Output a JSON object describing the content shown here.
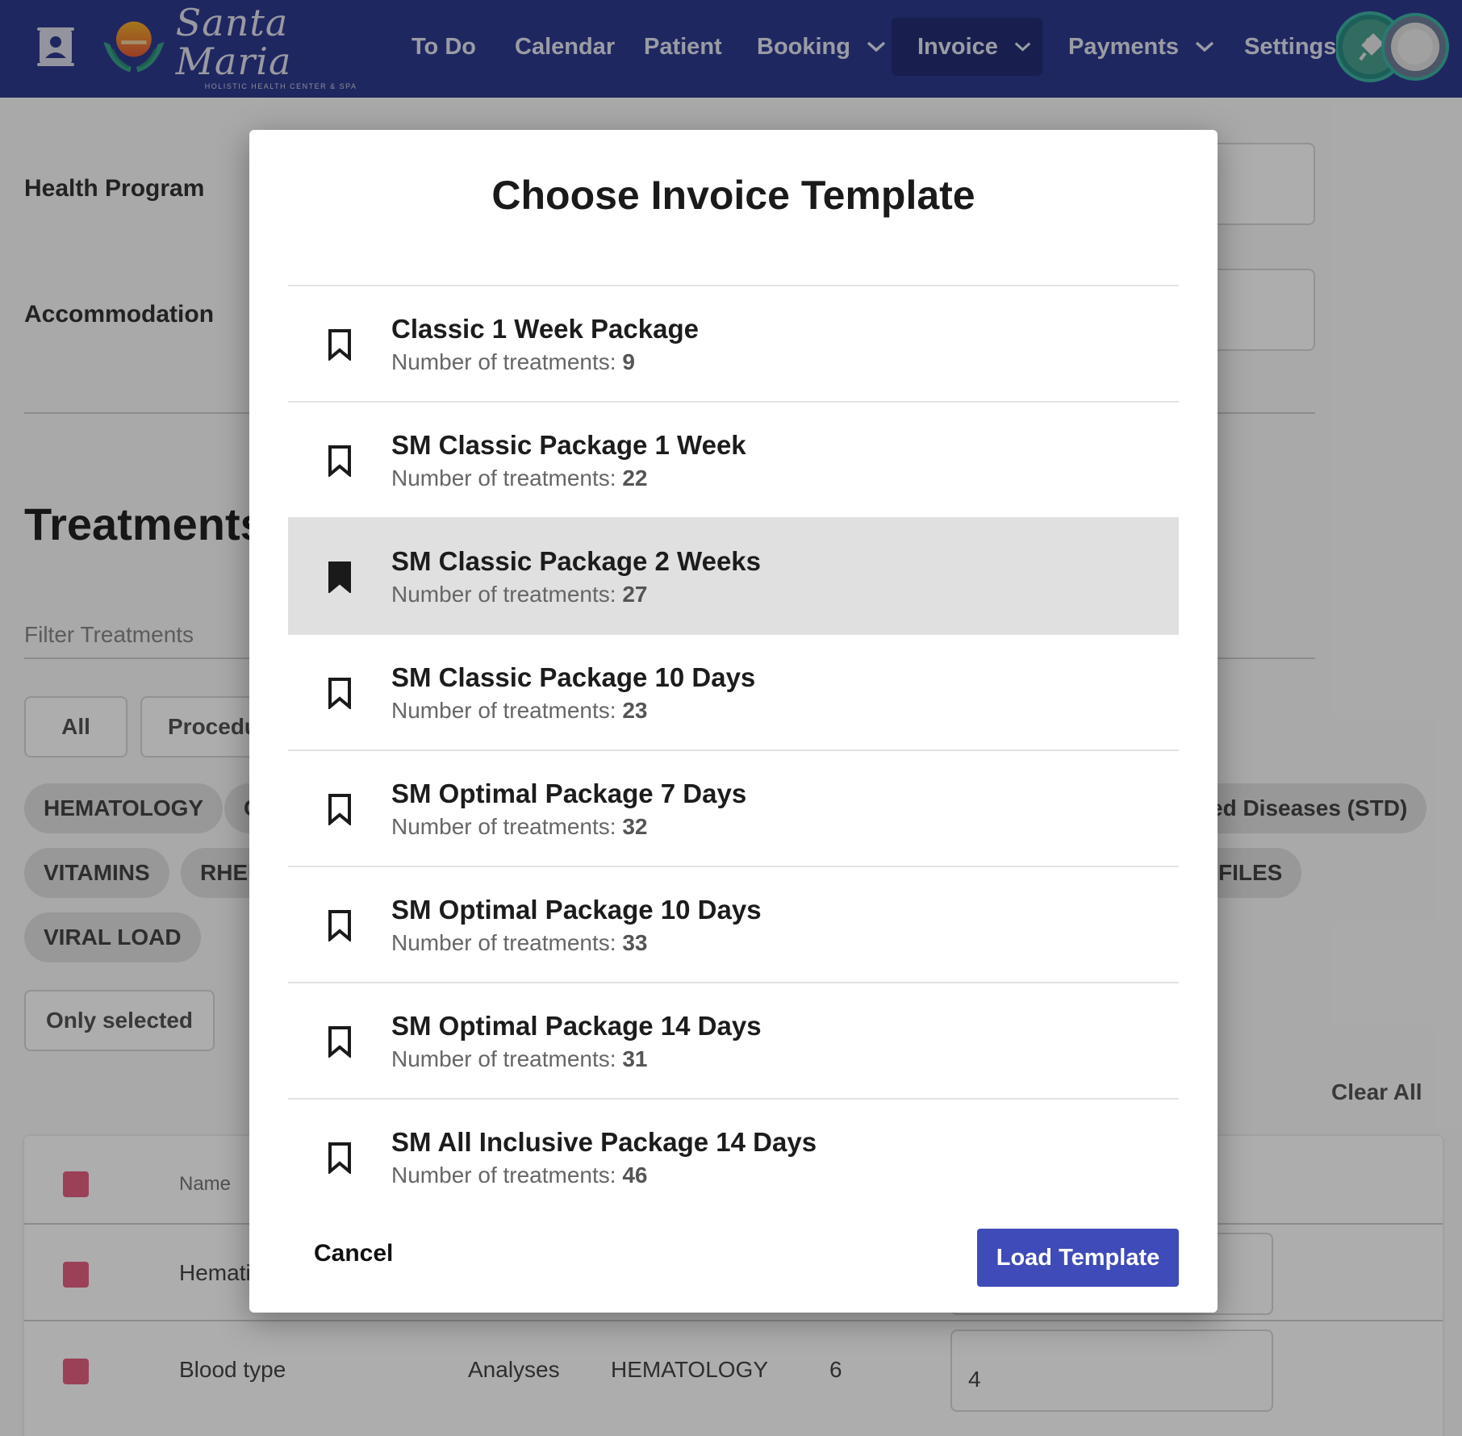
{
  "nav": {
    "brand_name": "Santa Maria",
    "brand_tagline": "HOLISTIC HEALTH CENTER & SPA",
    "items": [
      {
        "label": "To Do"
      },
      {
        "label": "Calendar"
      },
      {
        "label": "Patient"
      },
      {
        "label": "Booking"
      },
      {
        "label": "Invoice"
      },
      {
        "label": "Payments"
      },
      {
        "label": "Settings"
      }
    ],
    "active_item": "Invoice",
    "colors": {
      "bar": "#2f3a8f",
      "active": "#242d73"
    }
  },
  "background": {
    "health_program_label": "Health Program",
    "accommodation_label": "Accommodation",
    "treatments_title": "Treatments",
    "filter_placeholder": "Filter Treatments",
    "filter_buttons": [
      "All",
      "Procedu"
    ],
    "chips": [
      "HEMATOLOGY",
      "C",
      "ed Diseases (STD)",
      "VITAMINS",
      "RHEU",
      "FILES",
      "VIRAL LOAD"
    ],
    "only_selected": "Only selected",
    "clear_all": "Clear All",
    "table": {
      "header_name": "Name",
      "rows": [
        {
          "name": "Hemati",
          "type": "",
          "category": "",
          "qty": "",
          "value": ""
        },
        {
          "name": "Blood type",
          "type": "Analyses",
          "category": "HEMATOLOGY",
          "qty": "6",
          "value": "4"
        }
      ]
    }
  },
  "modal": {
    "title": "Choose Invoice Template",
    "sub_prefix": "Number of treatments: ",
    "templates": [
      {
        "name": "Classic 1 Week Package",
        "treatments": "9"
      },
      {
        "name": "SM Classic Package 1 Week",
        "treatments": "22"
      },
      {
        "name": "SM Classic Package 2 Weeks",
        "treatments": "27"
      },
      {
        "name": "SM Classic Package 10 Days",
        "treatments": "23"
      },
      {
        "name": "SM Optimal Package 7 Days",
        "treatments": "32"
      },
      {
        "name": "SM Optimal Package 10 Days",
        "treatments": "33"
      },
      {
        "name": "SM Optimal Package 14 Days",
        "treatments": "31"
      },
      {
        "name": "SM All Inclusive Package 14 Days",
        "treatments": "46"
      }
    ],
    "selected_template": "SM Classic Package 2 Weeks",
    "cancel_label": "Cancel",
    "load_label": "Load Template",
    "accent_color": "#3f4bb8"
  }
}
